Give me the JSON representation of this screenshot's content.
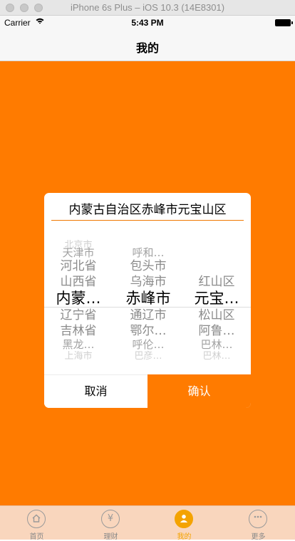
{
  "simulator": {
    "title": "iPhone 6s Plus – iOS 10.3 (14E8301)"
  },
  "status_bar": {
    "carrier": "Carrier",
    "wifi_icon": "wifi-icon",
    "time": "5:43 PM",
    "battery_icon": "battery-icon"
  },
  "nav": {
    "title": "我的"
  },
  "colors": {
    "accent": "#ff7b00",
    "tab_active": "#f4a300",
    "tabbar_bg": "#f9d6bd"
  },
  "dialog": {
    "title": "内蒙古自治区赤峰市元宝山区",
    "picker": {
      "province": [
        "北京市",
        "天津市",
        "河北省",
        "山西省",
        "内蒙…",
        "辽宁省",
        "吉林省",
        "黑龙…",
        "上海市"
      ],
      "city": [
        "呼和…",
        "包头市",
        "乌海市",
        "赤峰市",
        "通辽市",
        "鄂尔…",
        "呼伦…",
        "巴彦…"
      ],
      "district": [
        "红山区",
        "元宝…",
        "松山区",
        "阿鲁…",
        "巴林…",
        "巴林…"
      ]
    },
    "cancel_label": "取消",
    "confirm_label": "确认"
  },
  "tabbar": {
    "items": [
      {
        "label": "首页",
        "icon": "home-icon"
      },
      {
        "label": "理财",
        "icon": "yen-icon"
      },
      {
        "label": "我的",
        "icon": "person-icon"
      },
      {
        "label": "更多",
        "icon": "more-icon"
      }
    ],
    "active_index": 2
  }
}
